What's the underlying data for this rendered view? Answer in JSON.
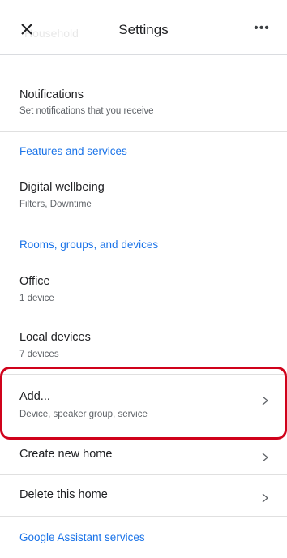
{
  "header": {
    "title": "Settings",
    "ghost_text": "Household",
    "close_icon": "close-icon",
    "more_icon": "more-horiz-icon",
    "more_glyph": "•••"
  },
  "notifications": {
    "label": "Notifications",
    "sub": "Set notifications that you receive"
  },
  "features_section": "Features and services",
  "digital_wellbeing": {
    "label": "Digital wellbeing",
    "sub": "Filters, Downtime"
  },
  "rooms_section": "Rooms, groups, and devices",
  "office": {
    "label": "Office",
    "sub": "1 device"
  },
  "local_devices": {
    "label": "Local devices",
    "sub": "7 devices"
  },
  "add": {
    "label": "Add...",
    "sub": "Device, speaker group, service"
  },
  "create_home": {
    "label": "Create new home"
  },
  "delete_home": {
    "label": "Delete this home"
  },
  "assistant_section": "Google Assistant services",
  "colors": {
    "accent": "#1a73e8",
    "highlight": "#d0021b"
  }
}
